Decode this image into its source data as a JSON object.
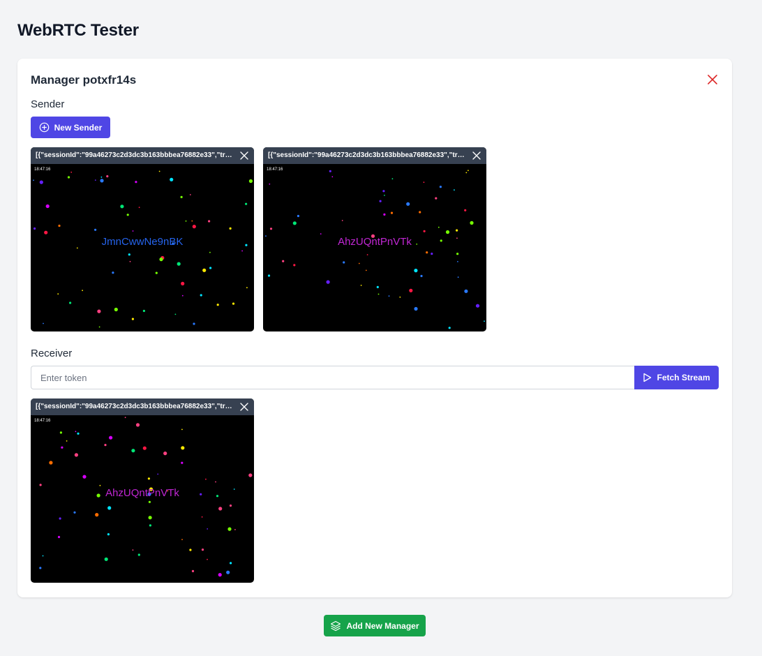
{
  "app": {
    "title": "WebRTC Tester"
  },
  "manager": {
    "title": "Manager potxfr14s",
    "close_icon": "close-icon",
    "close_color": "#dc2626"
  },
  "sender": {
    "label": "Sender",
    "new_button_label": "New Sender",
    "new_button_icon": "plus-circle-icon",
    "streams": [
      {
        "header": "[{\"sessionId\":\"99a46273c2d3dc3b163bbbea76882e33\",\"trackId\":\"",
        "timestamp": "18:47:16",
        "label": "JmnCwwNe9nBK",
        "label_color": "#2563eb"
      },
      {
        "header": "[{\"sessionId\":\"99a46273c2d3dc3b163bbbea76882e33\",\"trackId\":\"",
        "timestamp": "18:47:16",
        "label": "AhzUQntPnVTk",
        "label_color": "#c026d3"
      }
    ]
  },
  "receiver": {
    "label": "Receiver",
    "input_placeholder": "Enter token",
    "input_value": "",
    "fetch_button_label": "Fetch Stream",
    "fetch_button_icon": "play-icon",
    "streams": [
      {
        "header": "[{\"sessionId\":\"99a46273c2d3dc3b163bbbea76882e33\",\"trackId\":\"",
        "timestamp": "18:47:16",
        "label": "AhzUQntPnVTk",
        "label_color": "#c026d3"
      }
    ]
  },
  "footer": {
    "add_manager_label": "Add New Manager",
    "add_manager_icon": "layers-icon"
  },
  "colors": {
    "primary": "#4f46e5",
    "success": "#16a34a",
    "danger": "#dc2626",
    "tile_header": "#374151"
  }
}
